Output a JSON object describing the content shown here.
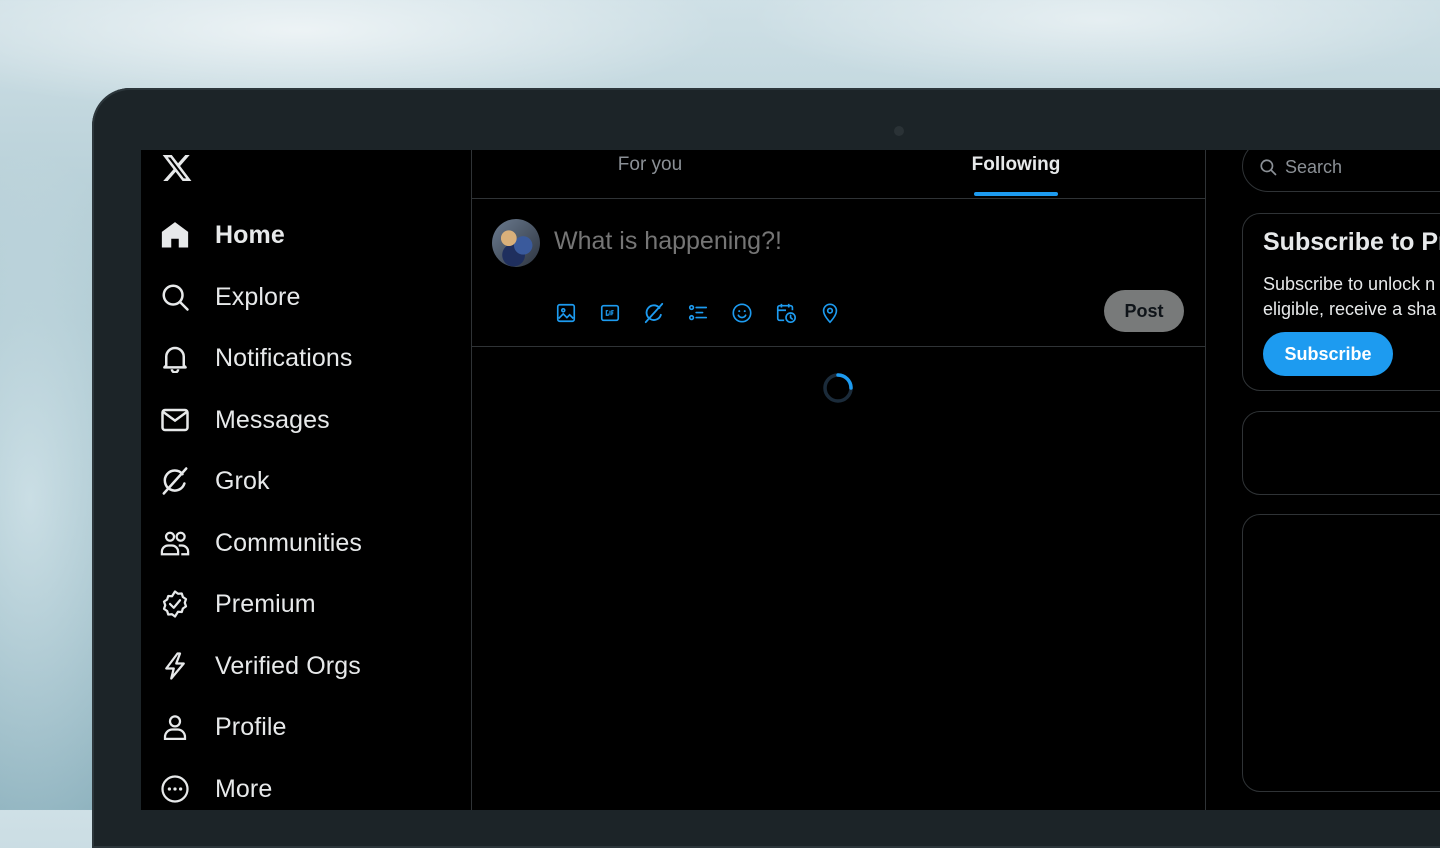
{
  "sidebar": {
    "items": [
      {
        "label": "Home",
        "icon": "home-icon",
        "active": true
      },
      {
        "label": "Explore",
        "icon": "search-icon"
      },
      {
        "label": "Notifications",
        "icon": "bell-icon"
      },
      {
        "label": "Messages",
        "icon": "envelope-icon"
      },
      {
        "label": "Grok",
        "icon": "grok-icon"
      },
      {
        "label": "Communities",
        "icon": "people-icon"
      },
      {
        "label": "Premium",
        "icon": "verified-badge-icon"
      },
      {
        "label": "Verified Orgs",
        "icon": "lightning-icon"
      },
      {
        "label": "Profile",
        "icon": "person-icon"
      },
      {
        "label": "More",
        "icon": "more-circle-icon"
      }
    ]
  },
  "tabs": {
    "for_you": "For you",
    "following": "Following",
    "active": "Following"
  },
  "composer": {
    "placeholder": "What is happening?!",
    "post_label": "Post",
    "tools": [
      "image-icon",
      "gif-icon",
      "grok-icon",
      "poll-icon",
      "emoji-icon",
      "schedule-icon",
      "location-icon"
    ]
  },
  "right": {
    "search_placeholder": "Search",
    "subscribe_card": {
      "title": "Subscribe to Pr",
      "text_line1": "Subscribe to unlock n",
      "text_line2": "eligible, receive a sha",
      "button_label": "Subscribe"
    }
  },
  "colors": {
    "accent": "#1d9bf0",
    "background": "#000000",
    "border": "#2f3336",
    "text": "#e7e9ea",
    "muted": "#8b9096"
  }
}
